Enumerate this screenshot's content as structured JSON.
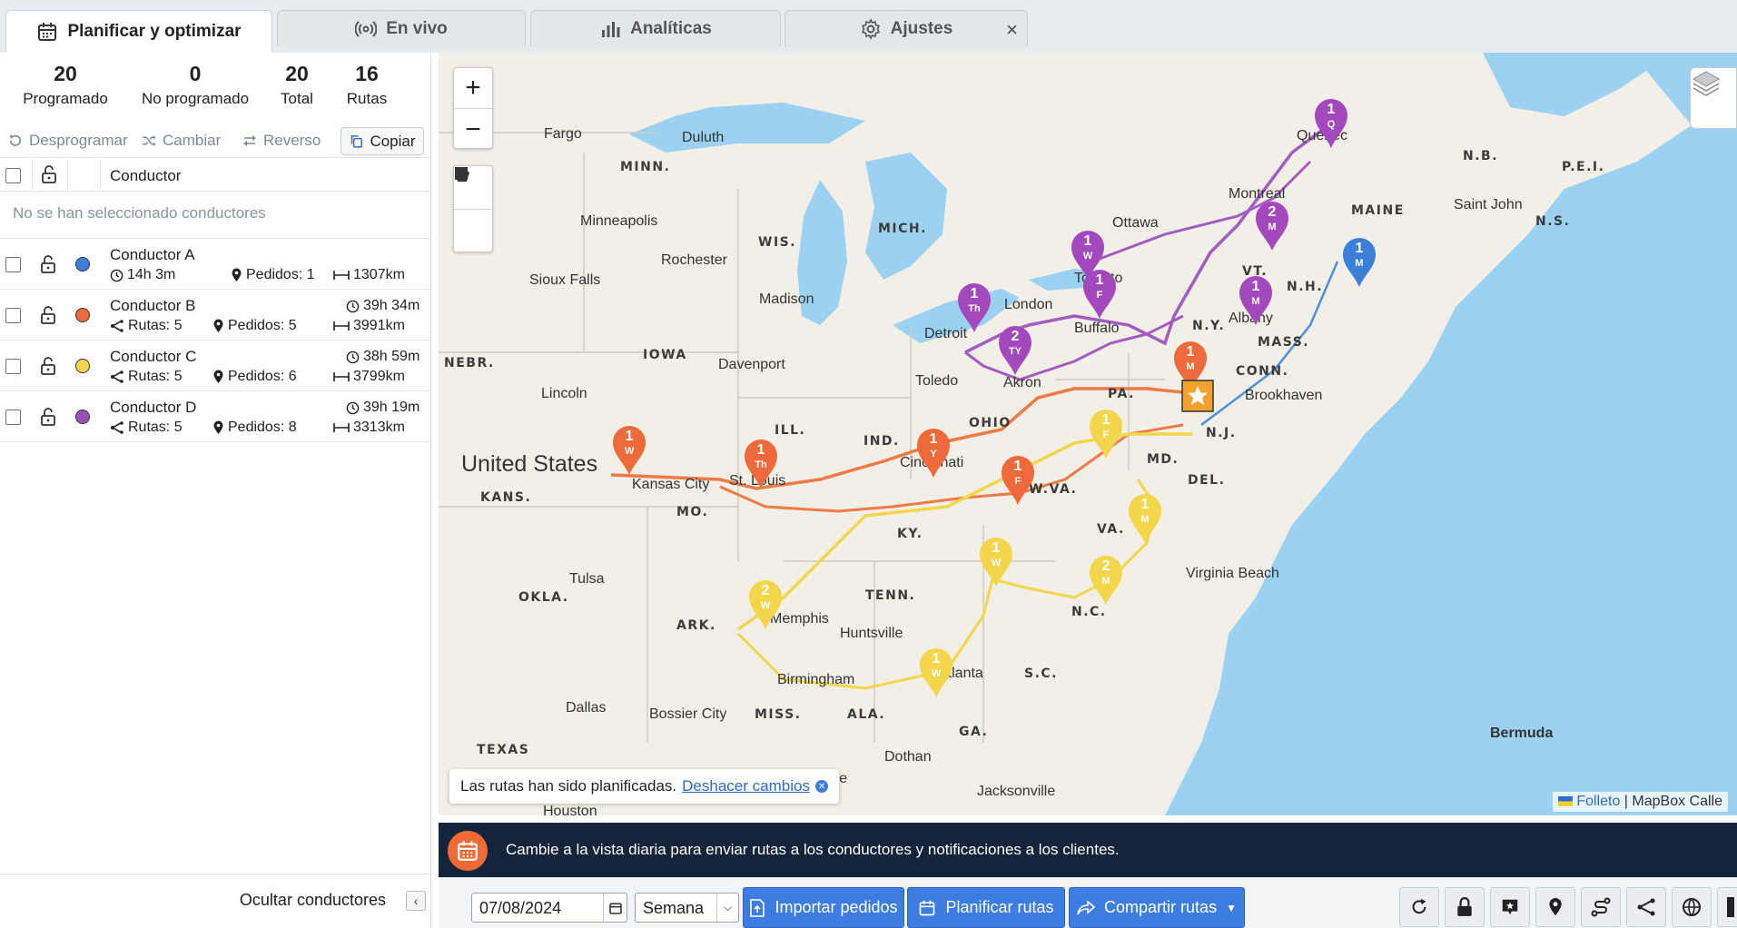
{
  "tabs": [
    {
      "label": "Planificar y optimizar",
      "icon": "calendar-icon",
      "active": true
    },
    {
      "label": "En vivo",
      "icon": "broadcast-icon"
    },
    {
      "label": "Analíticas",
      "icon": "bar-chart-icon"
    },
    {
      "label": "Ajustes",
      "icon": "gear-icon"
    }
  ],
  "stats": [
    {
      "value": "20",
      "label": "Programado"
    },
    {
      "value": "0",
      "label": "No programado"
    },
    {
      "value": "20",
      "label": "Total"
    },
    {
      "value": "16",
      "label": "Rutas"
    }
  ],
  "actions": {
    "unschedule": "Desprogramar",
    "change": "Cambiar",
    "reverse": "Reverso",
    "copy": "Copiar"
  },
  "table": {
    "header": "Conductor",
    "empty_note": "No se han seleccionado conductores"
  },
  "drivers": [
    {
      "name": "Conductor A",
      "color": "#3b7fd8",
      "time": "14h 3m",
      "orders": "Pedidos: 1",
      "distance": "1307km"
    },
    {
      "name": "Conductor B",
      "color": "#ee6a3a",
      "time": "39h 34m",
      "routes": "Rutas: 5",
      "orders": "Pedidos: 5",
      "distance": "3991km"
    },
    {
      "name": "Conductor C",
      "color": "#f3d64b",
      "time": "38h 59m",
      "routes": "Rutas: 5",
      "orders": "Pedidos: 6",
      "distance": "3799km"
    },
    {
      "name": "Conductor D",
      "color": "#9c4fb8",
      "time": "39h 19m",
      "routes": "Rutas: 5",
      "orders": "Pedidos: 8",
      "distance": "3313km"
    }
  ],
  "sidebar_footer": {
    "hide_drivers": "Ocultar conductores"
  },
  "map": {
    "country": "United States",
    "states": [
      "MINN.",
      "WIS.",
      "MICH.",
      "IOWA",
      "NEBR.",
      "ILL.",
      "IND.",
      "OHIO",
      "PA.",
      "N.Y.",
      "VT.",
      "N.H.",
      "MAINE",
      "MASS.",
      "CONN.",
      "N.J.",
      "MD.",
      "DEL.",
      "W.VA.",
      "VA.",
      "KY.",
      "TENN.",
      "N.C.",
      "S.C.",
      "GA.",
      "ALA.",
      "MISS.",
      "ARK.",
      "MO.",
      "KANS.",
      "OKLA.",
      "TEXAS",
      "N.B.",
      "P.E.I.",
      "N.S."
    ],
    "cities": [
      "Fargo",
      "Duluth",
      "Minneapolis",
      "Rochester",
      "Madison",
      "Sioux Falls",
      "Davenport",
      "Lincoln",
      "Kansas City",
      "St. Louis",
      "Cincinnati",
      "Toledo",
      "Akron",
      "Detroit",
      "London",
      "Toronto",
      "Buffalo",
      "Ottawa",
      "Montreal",
      "Quebec",
      "Albany",
      "Brookhaven",
      "Saint John",
      "Tulsa",
      "Memphis",
      "Huntsville",
      "Birmingham",
      "Atlanta",
      "Dallas",
      "Bossier City",
      "Dothan",
      "Mobile",
      "Jacksonville",
      "Virginia Beach",
      "Houston",
      "Bermuda"
    ],
    "toast_text": "Las rutas han sido planificadas.",
    "toast_undo": "Deshacer cambios",
    "attribution_link": "Folleto",
    "attribution_text": "| MapBox Calle"
  },
  "banner": {
    "message": "Cambie a la vista diaria para enviar rutas a los conductores y notificaciones a los clientes."
  },
  "toolbar": {
    "date": "07/08/2024",
    "period": "Semana",
    "import": "Importar pedidos",
    "plan": "Planificar rutas",
    "share": "Compartir rutas"
  }
}
